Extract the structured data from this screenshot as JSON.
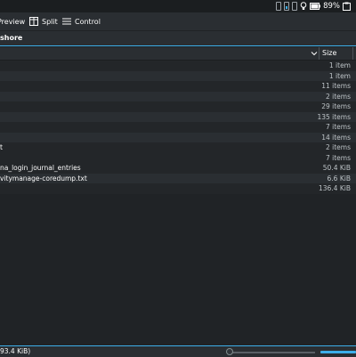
{
  "tray": {
    "battery_text": "89%"
  },
  "toolbar": {
    "preview_label": "Preview",
    "split_label": "Split",
    "control_label": "Control"
  },
  "location": {
    "path": "shore"
  },
  "header": {
    "size_label": "Size"
  },
  "rows": [
    {
      "name": "",
      "size": "1 item"
    },
    {
      "name": "",
      "size": "1 item"
    },
    {
      "name": "",
      "size": "11 items"
    },
    {
      "name": "",
      "size": "2 items"
    },
    {
      "name": "",
      "size": "29 items"
    },
    {
      "name": "",
      "size": "135 items"
    },
    {
      "name": "",
      "size": "7 items"
    },
    {
      "name": "",
      "size": "14 items"
    },
    {
      "name": "t",
      "size": "2 items"
    },
    {
      "name": "",
      "size": "7 items"
    },
    {
      "name": "na_login_journal_entries",
      "size": "50.4 KiB"
    },
    {
      "name": "vitymanage-coredump.txt",
      "size": "6.6 KiB"
    },
    {
      "name": "",
      "size": "136.4 KiB"
    }
  ],
  "status": {
    "text": "93.4 KiB)"
  },
  "zoom": {
    "level": 0.0
  },
  "space": {
    "fill": 1.0
  },
  "colors": {
    "accent": "#3daee9",
    "background": "#202326",
    "alt_row": "#2a2e32"
  }
}
